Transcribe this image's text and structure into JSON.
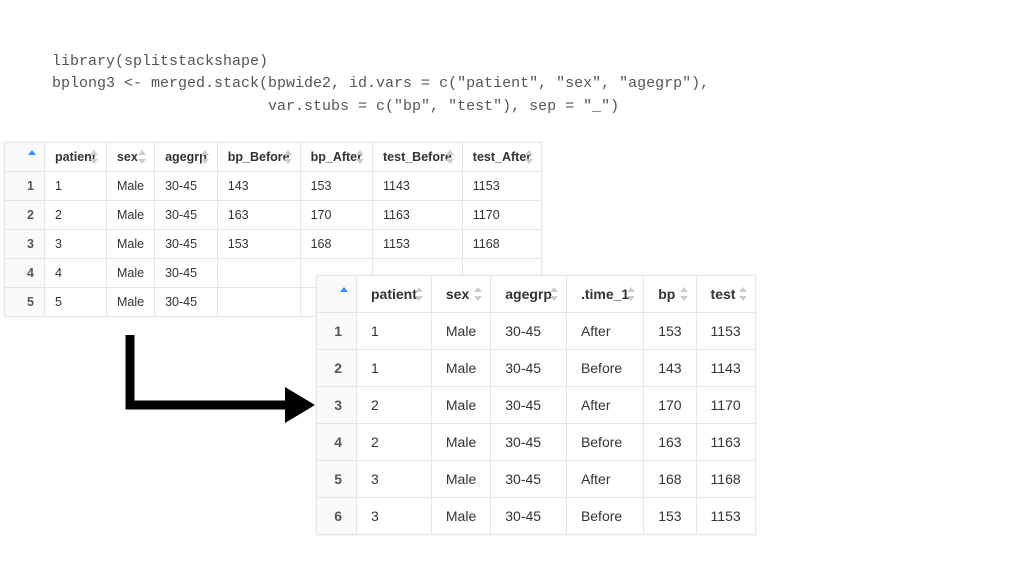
{
  "code": {
    "line1": "library(splitstackshape)",
    "line2": "bplong3 <- merged.stack(bpwide2, id.vars = c(\"patient\", \"sex\", \"agegrp\"),",
    "line3": "                        var.stubs = c(\"bp\", \"test\"), sep = \"_\")"
  },
  "table1": {
    "columns": [
      "patient",
      "sex",
      "agegrp",
      "bp_Before",
      "bp_After",
      "test_Before",
      "test_After"
    ],
    "rows": [
      {
        "idx": "1",
        "patient": "1",
        "sex": "Male",
        "agegrp": "30-45",
        "bp_Before": "143",
        "bp_After": "153",
        "test_Before": "1143",
        "test_After": "1153"
      },
      {
        "idx": "2",
        "patient": "2",
        "sex": "Male",
        "agegrp": "30-45",
        "bp_Before": "163",
        "bp_After": "170",
        "test_Before": "1163",
        "test_After": "1170"
      },
      {
        "idx": "3",
        "patient": "3",
        "sex": "Male",
        "agegrp": "30-45",
        "bp_Before": "153",
        "bp_After": "168",
        "test_Before": "1153",
        "test_After": "1168"
      },
      {
        "idx": "4",
        "patient": "4",
        "sex": "Male",
        "agegrp": "30-45",
        "bp_Before": "",
        "bp_After": "",
        "test_Before": "",
        "test_After": ""
      },
      {
        "idx": "5",
        "patient": "5",
        "sex": "Male",
        "agegrp": "30-45",
        "bp_Before": "",
        "bp_After": "",
        "test_Before": "",
        "test_After": ""
      }
    ]
  },
  "table2": {
    "columns": [
      "patient",
      "sex",
      "agegrp",
      ".time_1",
      "bp",
      "test"
    ],
    "rows": [
      {
        "idx": "1",
        "patient": "1",
        "sex": "Male",
        "agegrp": "30-45",
        "time": "After",
        "bp": "153",
        "test": "1153"
      },
      {
        "idx": "2",
        "patient": "1",
        "sex": "Male",
        "agegrp": "30-45",
        "time": "Before",
        "bp": "143",
        "test": "1143"
      },
      {
        "idx": "3",
        "patient": "2",
        "sex": "Male",
        "agegrp": "30-45",
        "time": "After",
        "bp": "170",
        "test": "1170"
      },
      {
        "idx": "4",
        "patient": "2",
        "sex": "Male",
        "agegrp": "30-45",
        "time": "Before",
        "bp": "163",
        "test": "1163"
      },
      {
        "idx": "5",
        "patient": "3",
        "sex": "Male",
        "agegrp": "30-45",
        "time": "After",
        "bp": "168",
        "test": "1168"
      },
      {
        "idx": "6",
        "patient": "3",
        "sex": "Male",
        "agegrp": "30-45",
        "time": "Before",
        "bp": "153",
        "test": "1153"
      }
    ]
  }
}
